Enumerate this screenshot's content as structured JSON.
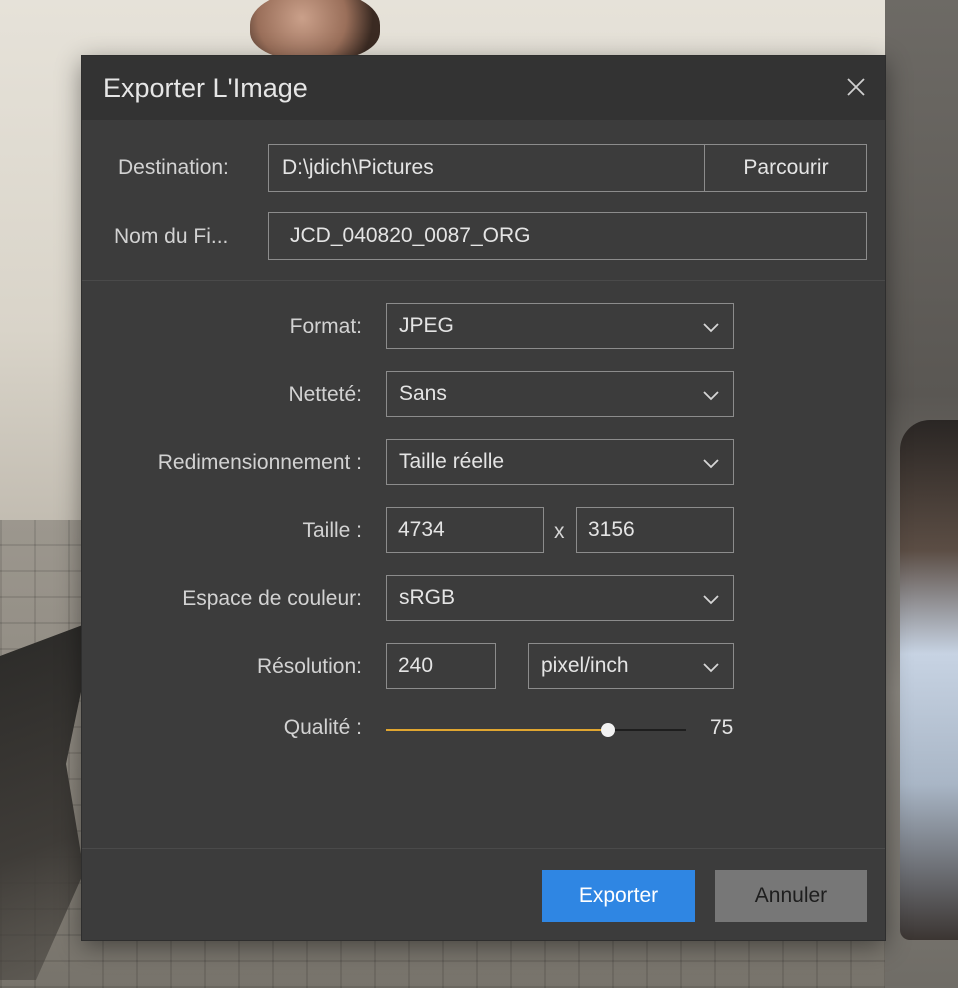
{
  "dialog": {
    "title": "Exporter L'Image",
    "close_icon": "close-icon"
  },
  "destination": {
    "label": "Destination:",
    "value": "D:\\jdich\\Pictures",
    "browse_label": "Parcourir"
  },
  "filename": {
    "label": "Nom du Fi...",
    "value": "JCD_040820_0087_ORG"
  },
  "format": {
    "label": "Format:",
    "value": "JPEG"
  },
  "sharpness": {
    "label": "Netteté:",
    "value": "Sans"
  },
  "resize": {
    "label": "Redimensionnement :",
    "value": "Taille réelle"
  },
  "size": {
    "label": "Taille :",
    "width": "4734",
    "separator": "x",
    "height": "3156"
  },
  "colorspace": {
    "label": "Espace de couleur:",
    "value": "sRGB"
  },
  "resolution": {
    "label": "Résolution:",
    "value": "240",
    "unit": "pixel/inch"
  },
  "quality": {
    "label": "Qualité :",
    "value": "75",
    "fraction": 0.74
  },
  "buttons": {
    "export": "Exporter",
    "cancel": "Annuler"
  },
  "colors": {
    "accent": "#2f86e3",
    "slider_fill": "#e0a630",
    "dialog_bg": "#3c3c3c"
  }
}
